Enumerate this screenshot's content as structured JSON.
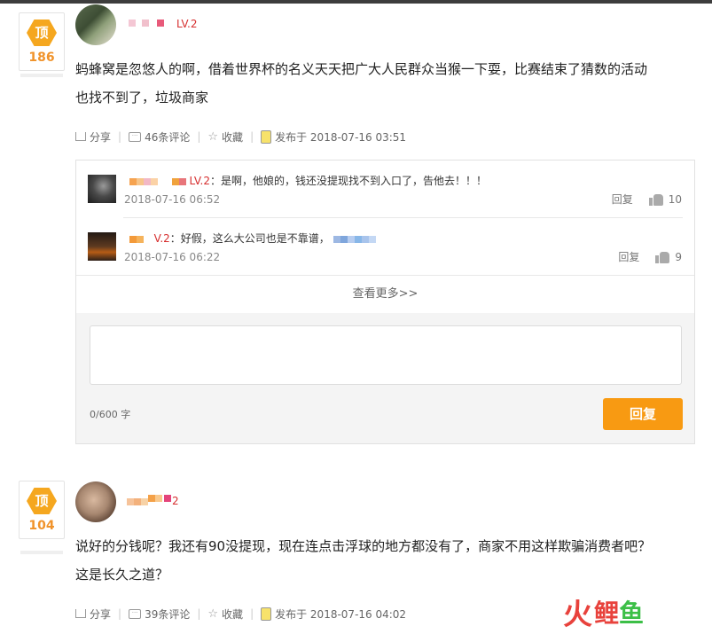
{
  "comments": [
    {
      "vote_label": "顶",
      "vote_count": "186",
      "level": "LV.2",
      "text_line1": "蚂蜂窝是忽悠人的啊，借着世界杯的名义天天把广大人民群众当猴一下耍，比赛结束了猜数的活动",
      "text_line2": "也找不到了，垃圾商家",
      "share": "分享",
      "comments_count": "46条评论",
      "favorite": "收藏",
      "published": "发布于 2018-07-16 03:51",
      "replies": [
        {
          "level": "LV.2",
          "text": "：是啊，他娘的，钱还没提现找不到入口了，告他去！！！",
          "time": "2018-07-16 06:52",
          "reply": "回复",
          "likes": "10"
        },
        {
          "level": "V.2",
          "text": "：好假，这么大公司也是不靠谱，",
          "time": "2018-07-16 06:22",
          "reply": "回复",
          "likes": "9"
        }
      ],
      "more": "查看更多>>",
      "counter": "0/600 字",
      "reply_button": "回复"
    },
    {
      "vote_label": "顶",
      "vote_count": "104",
      "level": "2",
      "text_line1": "说好的分钱呢？我还有90没提现，现在连点击浮球的地方都没有了，商家不用这样欺骗消费者吧？",
      "text_line2": "这是长久之道？",
      "share": "分享",
      "comments_count": "39条评论",
      "favorite": "收藏",
      "published": "发布于 2018-07-16 04:02"
    }
  ],
  "watermark": {
    "part1": "火",
    "part2": "鲤",
    "part3": "鱼"
  },
  "colors": {
    "accent": "#f89a12",
    "vote": "#f5a71f",
    "level": "#d62f2f"
  }
}
